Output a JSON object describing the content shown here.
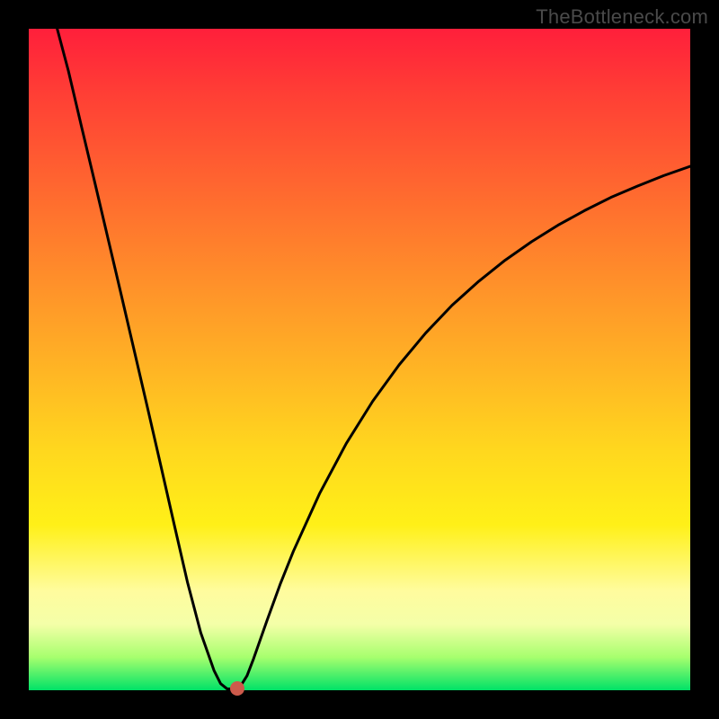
{
  "attribution": "TheBottleneck.com",
  "colors": {
    "frame": "#000000",
    "curve": "#000000",
    "marker": "#cc5a4b",
    "gradient_top": "#ff1f3b",
    "gradient_bottom": "#00e267"
  },
  "chart_data": {
    "type": "line",
    "title": "",
    "xlabel": "",
    "ylabel": "",
    "xlim": [
      0,
      100
    ],
    "ylim": [
      0,
      100
    ],
    "grid": false,
    "legend": false,
    "series": [
      {
        "name": "bottleneck-curve",
        "x": [
          4.3,
          6,
          8,
          10,
          12,
          14,
          16,
          18,
          20,
          22,
          24,
          26,
          28,
          29,
          30,
          31,
          32,
          33,
          34,
          36,
          38,
          40,
          44,
          48,
          52,
          56,
          60,
          64,
          68,
          72,
          76,
          80,
          84,
          88,
          92,
          96,
          100
        ],
        "y": [
          100,
          93.6,
          85.1,
          76.7,
          68.2,
          59.7,
          51.1,
          42.5,
          33.8,
          25.0,
          16.3,
          8.7,
          3.0,
          1.0,
          0.2,
          0.2,
          0.6,
          2.2,
          4.8,
          10.5,
          16.0,
          21.0,
          29.8,
          37.3,
          43.7,
          49.2,
          54.0,
          58.2,
          61.8,
          65.0,
          67.8,
          70.3,
          72.5,
          74.5,
          76.2,
          77.8,
          79.2
        ]
      }
    ],
    "marker": {
      "x": 31.5,
      "y": 0.3
    }
  }
}
